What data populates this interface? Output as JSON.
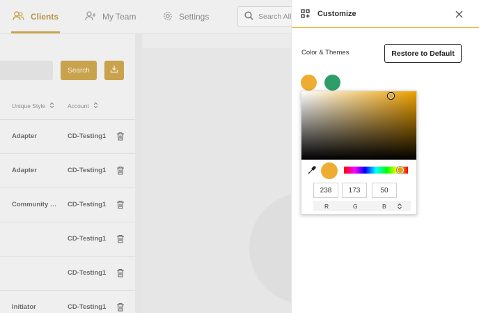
{
  "nav": {
    "clients": "Clients",
    "my_team": "My Team",
    "settings": "Settings",
    "search_placeholder": "Search All A"
  },
  "toolbar": {
    "search_button": "Search"
  },
  "table": {
    "columns": [
      "Unique Style",
      "Account"
    ],
    "rows": [
      {
        "style": "Adapter",
        "account": "CD-Testing1"
      },
      {
        "style": "Adapter",
        "account": "CD-Testing1"
      },
      {
        "style": "Community B...",
        "account": "CD-Testing1"
      },
      {
        "style": "",
        "account": "CD-Testing1"
      },
      {
        "style": "",
        "account": "CD-Testing1"
      },
      {
        "style": "Initiator",
        "account": "CD-Testing1"
      }
    ]
  },
  "panel": {
    "title": "Customize",
    "section_label": "Color & Themes",
    "restore_button": "Restore to Default",
    "swatches": [
      "#EEAD32",
      "#2E9E69"
    ]
  },
  "picker": {
    "r": "238",
    "g": "173",
    "b": "50",
    "labels": [
      "R",
      "G",
      "B"
    ],
    "selected_color": "#EEAD32"
  },
  "colors": {
    "accent": "#EEB62F",
    "nav_active": "#C9A24E"
  },
  "icons": {
    "clients": "users-icon",
    "my_team": "add-user-icon",
    "settings": "gear-icon",
    "search": "search-icon",
    "export": "download-icon",
    "row_action": "trash-icon",
    "panel": "grid-customize-icon",
    "close": "close-icon",
    "eyedropper": "eyedropper-icon"
  }
}
